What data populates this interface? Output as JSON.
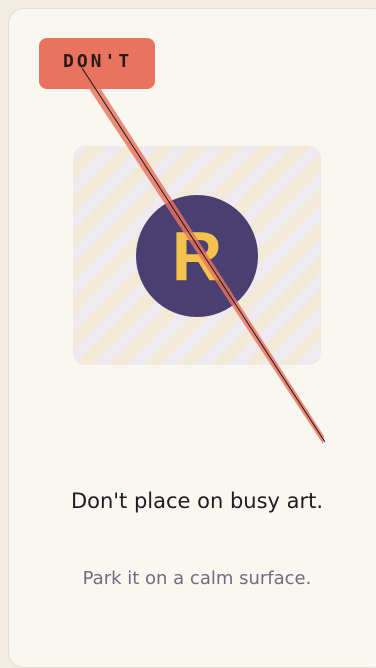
{
  "badge": {
    "label": "DON'T",
    "color": "#e8735f"
  },
  "preview": {
    "logo_letter": "R",
    "logo_bg_color": "#4b3f72",
    "logo_letter_color": "#f3c34d",
    "strike_color": "#e8735f"
  },
  "message": {
    "title": "Don't place on busy art.",
    "subtitle": "Park it on a calm surface."
  }
}
